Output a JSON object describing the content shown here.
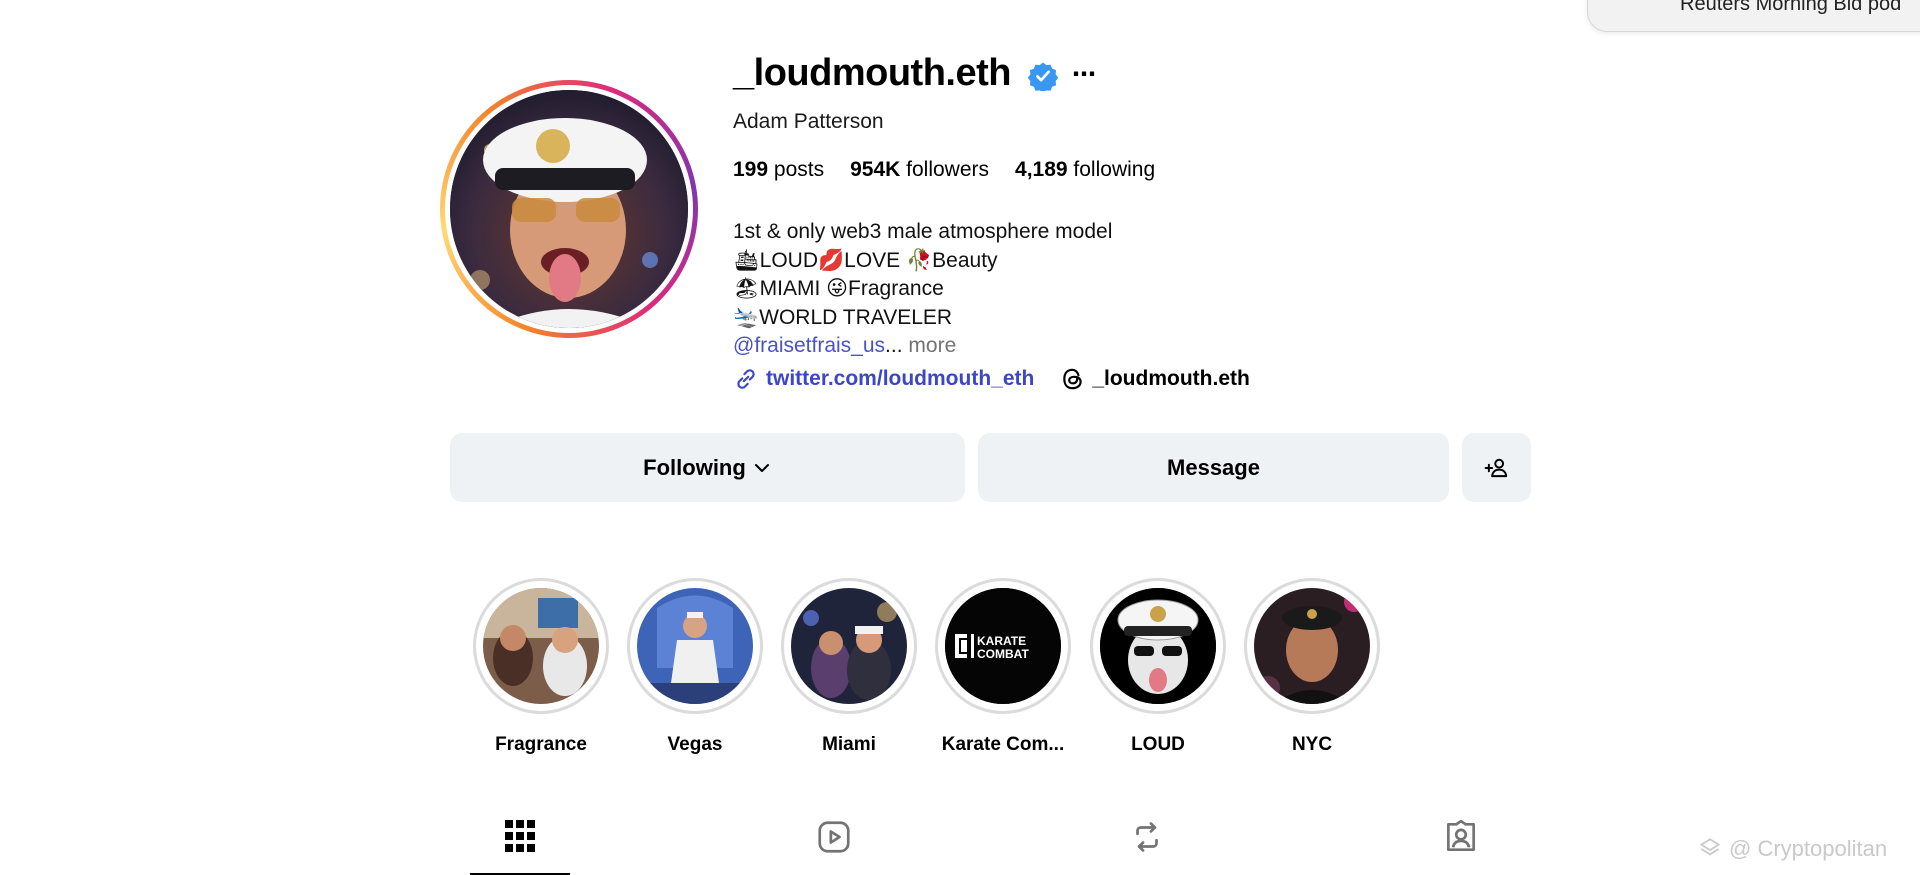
{
  "toast": {
    "text": "Reuters Morning Bid pod"
  },
  "profile": {
    "username": "_loudmouth.eth",
    "verified": true,
    "more_icon": "⋯",
    "full_name": "Adam Patterson",
    "stats": {
      "posts_count": "199",
      "posts_label": "posts",
      "followers_count": "954K",
      "followers_label": "followers",
      "following_count": "4,189",
      "following_label": "following"
    },
    "bio": {
      "line1": "1st & only web3 male atmosphere model",
      "line2": "🛳LOUD💋LOVE 🥀Beauty",
      "line3": "🏖MIAMI 😜Fragrance",
      "line4": "🛬WORLD TRAVELER",
      "mention": "@fraisetfrais_us",
      "ellipsis": "...",
      "more": "more"
    },
    "website": "twitter.com/loudmouth_eth",
    "threads_handle": "_loudmouth.eth"
  },
  "actions": {
    "following_label": "Following",
    "message_label": "Message"
  },
  "highlights": [
    {
      "label": "Fragrance"
    },
    {
      "label": "Vegas"
    },
    {
      "label": "Miami"
    },
    {
      "label": "Karate Com...",
      "logo_text_1": "KARATE",
      "logo_text_2": "COMBAT"
    },
    {
      "label": "LOUD"
    },
    {
      "label": "NYC"
    }
  ],
  "tabs": [
    {
      "icon": "grid-icon",
      "active": true
    },
    {
      "icon": "reels-icon",
      "active": false
    },
    {
      "icon": "reposts-icon",
      "active": false
    },
    {
      "icon": "tagged-icon",
      "active": false
    }
  ],
  "watermark": "@ Cryptopolitan",
  "colors": {
    "verified_blue": "#3897f0",
    "link_blue": "#3b47c6",
    "button_bg": "#eff2f5"
  }
}
